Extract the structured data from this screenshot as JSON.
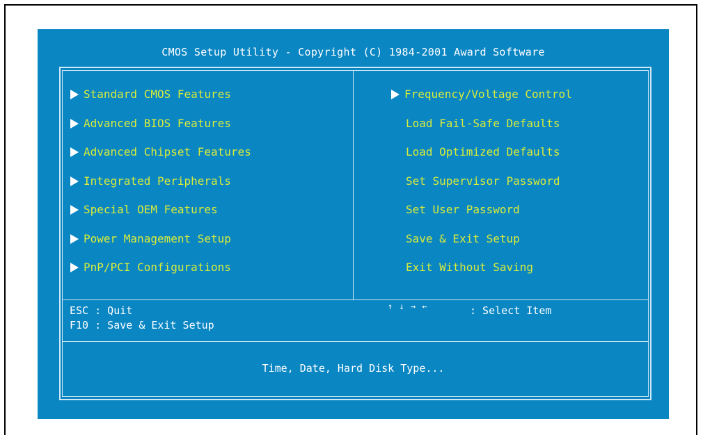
{
  "title": "CMOS Setup Utility - Copyright (C) 1984-2001 Award Software",
  "left_menu": [
    {
      "label": "Standard CMOS Features",
      "submenu": true
    },
    {
      "label": "Advanced BIOS Features",
      "submenu": true
    },
    {
      "label": "Advanced Chipset Features",
      "submenu": true
    },
    {
      "label": "Integrated Peripherals",
      "submenu": true
    },
    {
      "label": "Special OEM Features",
      "submenu": true
    },
    {
      "label": "Power Management Setup",
      "submenu": true
    },
    {
      "label": "PnP/PCI Configurations",
      "submenu": true
    }
  ],
  "right_menu": [
    {
      "label": "Frequency/Voltage Control",
      "submenu": true
    },
    {
      "label": "Load Fail-Safe Defaults",
      "submenu": false
    },
    {
      "label": "Load Optimized Defaults",
      "submenu": false
    },
    {
      "label": "Set Supervisor Password",
      "submenu": false
    },
    {
      "label": "Set User Password",
      "submenu": false
    },
    {
      "label": "Save & Exit Setup",
      "submenu": false
    },
    {
      "label": "Exit Without Saving",
      "submenu": false
    }
  ],
  "help": {
    "esc": "ESC : Quit",
    "f10": "F10 : Save & Exit Setup",
    "nav_arrows": "↑ ↓ → ←",
    "select": ": Select Item"
  },
  "status_text": "Time, Date, Hard Disk Type...",
  "colors": {
    "background": "#0a86c3",
    "menu_text": "#d8ec3a",
    "text": "#ffffff",
    "border": "#cfe8f5"
  }
}
